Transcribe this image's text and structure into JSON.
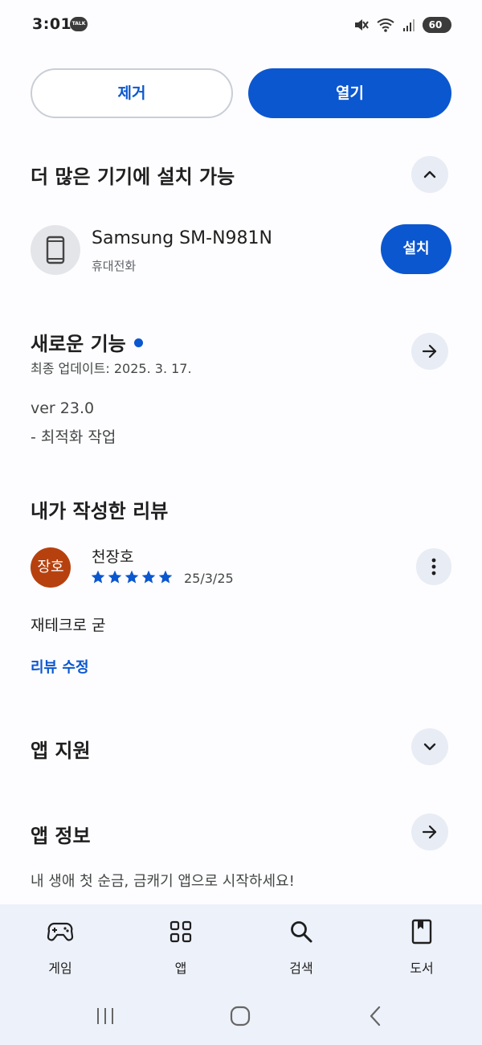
{
  "status_bar": {
    "time": "3:01",
    "notification_badge": "TALK",
    "battery": "60",
    "battery_level": 0.6,
    "icons": [
      "mute-icon",
      "wifi-icon",
      "signal-icon",
      "battery-icon"
    ]
  },
  "actions": {
    "remove_label": "제거",
    "open_label": "열기"
  },
  "devices": {
    "title": "더 많은 기기에 설치 가능",
    "device_name": "Samsung SM-N981N",
    "device_type": "휴대전화",
    "install_label": "설치"
  },
  "whats_new": {
    "title": "새로운 기능",
    "last_updated": "최종 업데이트: 2025. 3. 17.",
    "version": "ver 23.0",
    "notes": "- 최적화 작업"
  },
  "my_review": {
    "title": "내가 작성한 리뷰",
    "avatar_text": "장호",
    "reviewer_name": "천장호",
    "rating": 5,
    "max_rating": 5,
    "date": "25/3/25",
    "text": "재테크로 굳",
    "edit_label": "리뷰 수정"
  },
  "app_support": {
    "title": "앱 지원"
  },
  "app_info": {
    "title": "앱 정보",
    "description": "내 생애 첫 순금, 금캐기 앱으로 시작하세요!"
  },
  "bottom_nav": {
    "items": [
      {
        "label": "게임",
        "icon": "gamepad-icon"
      },
      {
        "label": "앱",
        "icon": "apps-grid-icon"
      },
      {
        "label": "검색",
        "icon": "search-icon"
      },
      {
        "label": "도서",
        "icon": "book-icon"
      }
    ]
  },
  "colors": {
    "accent": "#0b57d0",
    "avatar": "#b7410e",
    "nav_bg": "#edf1f9",
    "round_button_bg": "#e8ecf5"
  }
}
